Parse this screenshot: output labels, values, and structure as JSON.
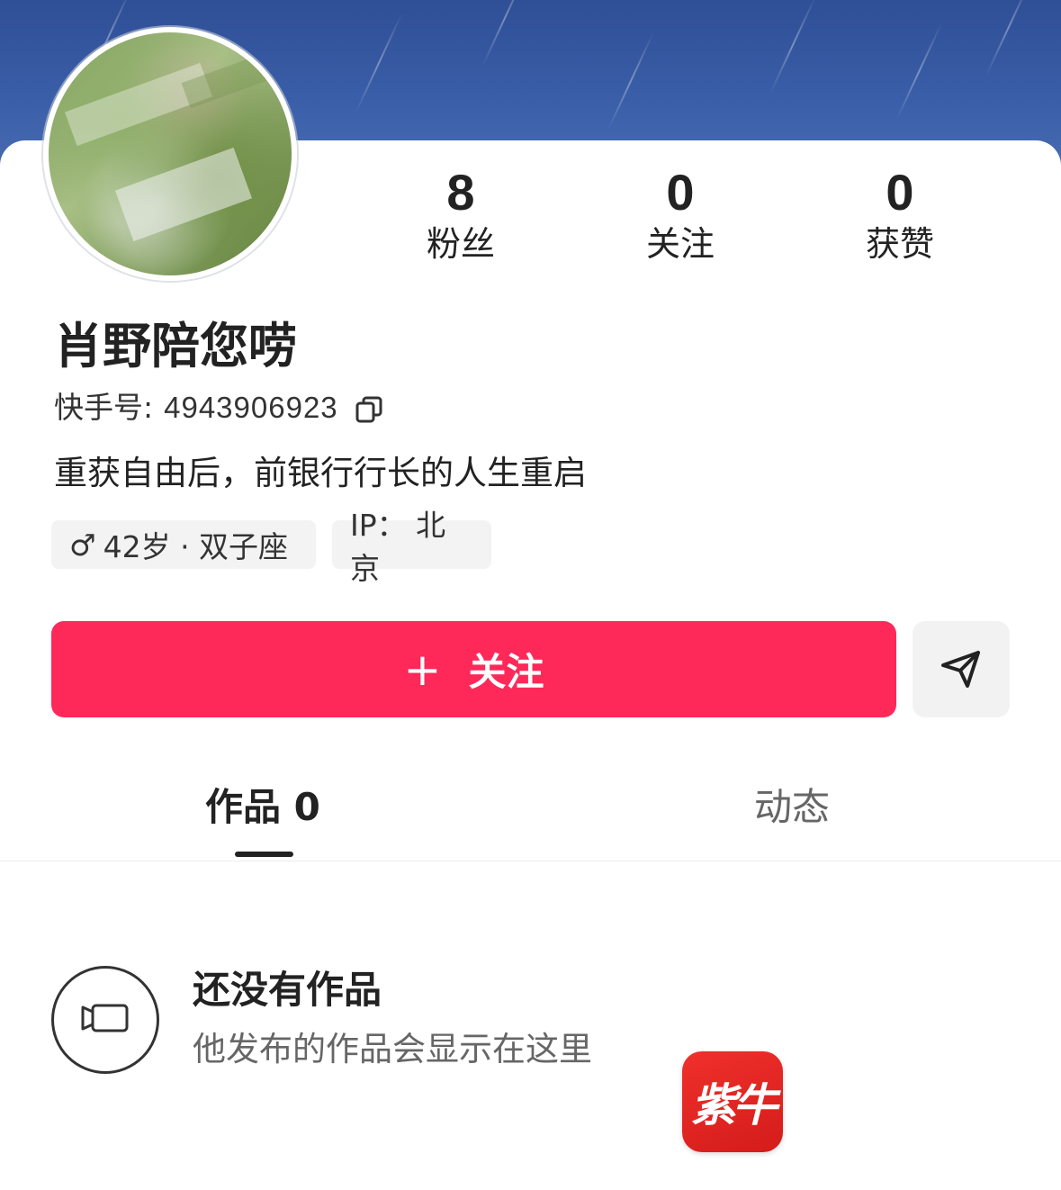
{
  "profile": {
    "name": "肖野陪您唠",
    "kuaishou_id_label": "快手号:",
    "kuaishou_id": "4943906923",
    "bio": "重获自由后，前银行行长的人生重启",
    "tags": {
      "gender_symbol": "♂",
      "age_sign": "42岁 · 双子座",
      "ip": "IP： 北京"
    }
  },
  "stats": [
    {
      "value": "8",
      "label": "粉丝"
    },
    {
      "value": "0",
      "label": "关注"
    },
    {
      "value": "0",
      "label": "获赞"
    }
  ],
  "actions": {
    "follow_plus": "+",
    "follow_label": "关注",
    "share_icon": "send-icon"
  },
  "tabs": [
    {
      "label": "作品 0",
      "active": true
    },
    {
      "label": "动态",
      "active": false
    }
  ],
  "empty_state": {
    "icon": "video-camera-icon",
    "title": "还没有作品",
    "subtitle": "他发布的作品会显示在这里"
  },
  "watermark": {
    "text": "紫牛"
  },
  "colors": {
    "accent": "#fe2859",
    "banner": "#3a5ea8",
    "text_primary": "#222222",
    "text_secondary": "#666666",
    "tag_bg": "#f3f3f3"
  }
}
